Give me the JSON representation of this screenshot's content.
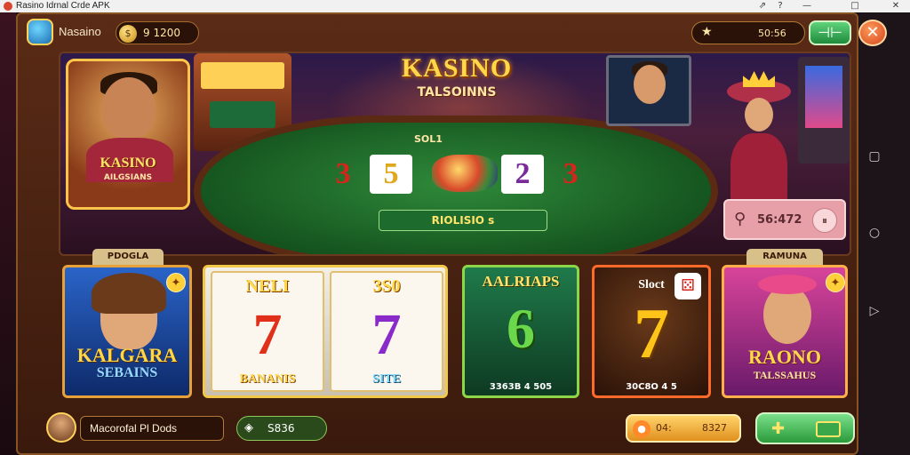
{
  "window": {
    "title": "Rasino Idrnal Crde APK",
    "controls": [
      "⇗",
      "?",
      "—",
      "□",
      "✕"
    ]
  },
  "android_nav": [
    "▢",
    "○",
    "▷"
  ],
  "header": {
    "brand": "Nasaino",
    "coins": "9 1200",
    "coin_icon": "coin-icon",
    "star_value": "50:56",
    "menu_symbol": "⊣⊢",
    "close_symbol": "✕"
  },
  "hero": {
    "title": "KASINO",
    "subtitle": "TALSOINNS",
    "portrait_title": "KASINO",
    "portrait_sub": "AILGSIANS",
    "table_label": "SOL1",
    "cards": [
      "3",
      "5",
      "2",
      "3"
    ],
    "table_banner": "RIOLISIO s",
    "score_value": "56:472",
    "score_btn": "⏸"
  },
  "tiles": [
    {
      "tab": "PDOGLA",
      "title": "KALGARA",
      "subtitle": "SEBAINS",
      "fav": "✦"
    },
    {
      "header_left": "NELI",
      "header_right": "3S0",
      "reel_left": "7",
      "reel_right": "7",
      "footer_left": "BANANIS",
      "footer_right": "SITE"
    },
    {
      "title": "AALRIAPS",
      "big": "6",
      "footer": "3363B 4 505"
    },
    {
      "title": "Sloct",
      "big": "7",
      "footer": "30C8O 4 5"
    },
    {
      "tab": "RAMUNA",
      "title": "RAONO",
      "subtitle": "TALSSAHUS",
      "fav": "✦"
    }
  ],
  "bottom": {
    "user_name": "Macorofal Pl Dods",
    "coins": "S836",
    "gold_label": "04:",
    "gold_value": "8327"
  },
  "colors": {
    "frame": "#5a2b16",
    "accent_gold": "#ffd84a",
    "green": "#2a9a3a"
  }
}
